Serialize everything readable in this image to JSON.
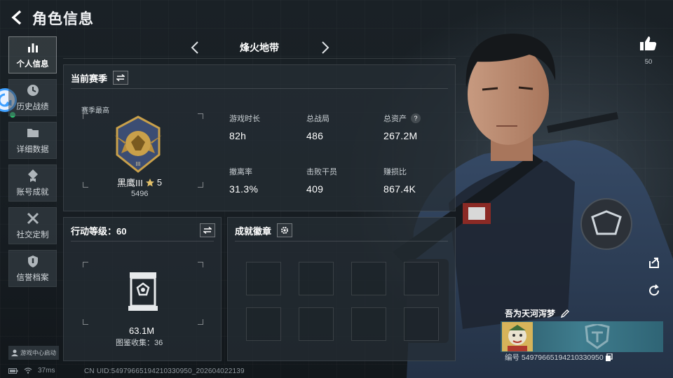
{
  "header": {
    "title": "角色信息"
  },
  "nav": {
    "items": [
      {
        "label": "个人信息",
        "icon": "bar-chart-icon",
        "active": true
      },
      {
        "label": "历史战绩",
        "icon": "clock-icon",
        "active": false
      },
      {
        "label": "详细数据",
        "icon": "folder-icon",
        "active": false
      },
      {
        "label": "账号成就",
        "icon": "medal-icon",
        "active": false
      },
      {
        "label": "社交定制",
        "icon": "tools-icon",
        "active": false
      },
      {
        "label": "信誉档案",
        "icon": "shield-icon",
        "active": false
      }
    ],
    "game_center": "游戏中心启动"
  },
  "mode": {
    "label": "烽火地带"
  },
  "season": {
    "title": "当前赛季",
    "sub_label": "赛季最高",
    "rank_name": "黑鹰III",
    "rank_stars": "5",
    "rank_points": "5496",
    "stats": [
      {
        "label": "游戏时长",
        "value": "82h"
      },
      {
        "label": "总战局",
        "value": "486"
      },
      {
        "label": "总资产",
        "value": "267.2M",
        "help": "?"
      },
      {
        "label": "撤离率",
        "value": "31.3%"
      },
      {
        "label": "击败干员",
        "value": "409"
      },
      {
        "label": "赚损比",
        "value": "867.4K"
      }
    ]
  },
  "action_level": {
    "title": "行动等级：60",
    "value": "63.1M",
    "collection": "图鉴收集：36"
  },
  "achievements": {
    "title": "成就徽章",
    "slots": 8
  },
  "profile": {
    "likes": "50",
    "name": "吾为天河泻梦",
    "uid_label": "编号 5497966519421033095​0"
  },
  "status": {
    "ping": "37ms",
    "uid": "CN UID:5497966519421033095​0_202604022139"
  },
  "colors": {
    "accent": "#3ea0ff",
    "gold": "#d6b45a",
    "banner": "#3f7d8e"
  }
}
